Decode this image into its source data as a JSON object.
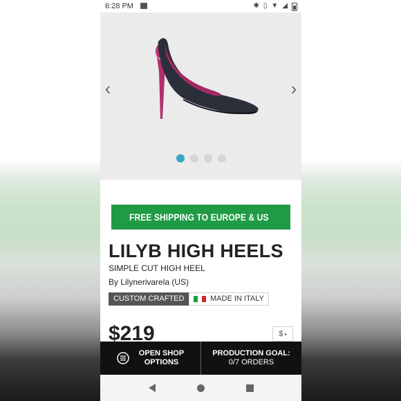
{
  "status_bar": {
    "time": "6:28 PM"
  },
  "carousel": {
    "prev_icon": "chevron-left-icon",
    "next_icon": "chevron-right-icon",
    "slide_count": 4,
    "active_index": 0,
    "colors": {
      "active_dot": "#38a9c6",
      "dot": "#d6d6d6"
    }
  },
  "shipping_banner": {
    "text": "FREE SHIPPING TO EUROPE & US",
    "icon": "airplane-icon",
    "color": "#1f9b45"
  },
  "product": {
    "title": "LILYB HIGH HEELS",
    "subtitle": "SIMPLE CUT HIGH HEEL",
    "by": "By Lilynerivarela (US)",
    "badge_custom": "CUSTOM CRAFTED",
    "badge_origin": "MADE IN ITALY",
    "price": "$219",
    "currency": "$"
  },
  "action_bar": {
    "open_shop": "OPEN SHOP\nOPTIONS",
    "goal_title": "PRODUCTION GOAL:",
    "goal_value": "0/7 ORDERS"
  },
  "nav_bar": {
    "back_icon": "back-triangle-icon",
    "home_icon": "home-circle-icon",
    "recent_icon": "recent-square-icon"
  }
}
